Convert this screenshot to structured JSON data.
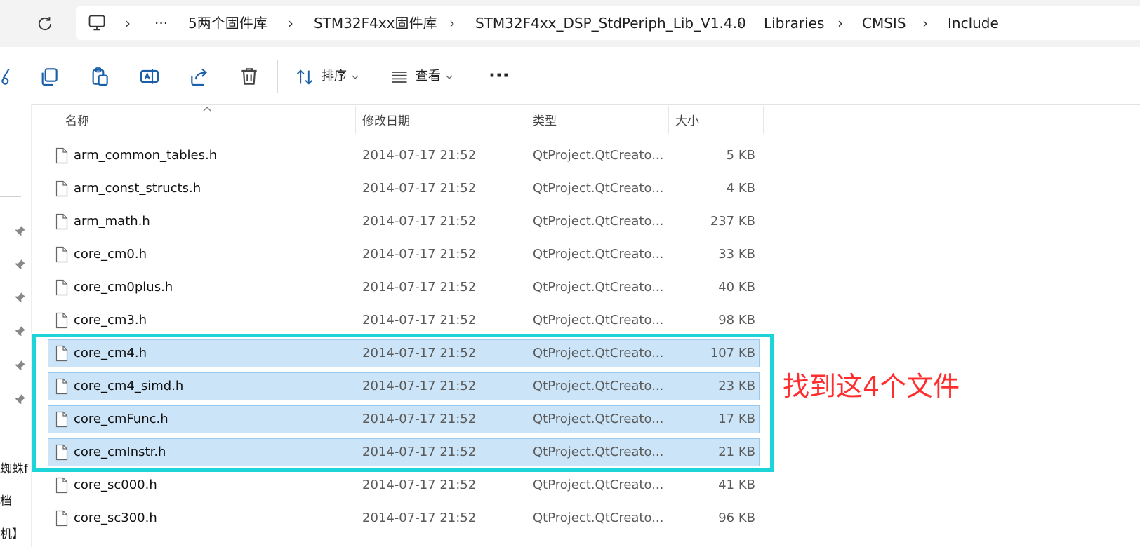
{
  "breadcrumbs": [
    "5两个固件库",
    "STM32F4xx固件库",
    "STM32F4xx_DSP_StdPeriph_Lib_V1.4.0",
    "Libraries",
    "CMSIS",
    "Include"
  ],
  "overflow_glyph": "···",
  "toolbar": {
    "sort_label": "排序",
    "view_label": "查看",
    "more_glyph": "···"
  },
  "columns": {
    "name": "名称",
    "date": "修改日期",
    "type": "类型",
    "size": "大小"
  },
  "files": [
    {
      "name": "arm_common_tables.h",
      "date": "2014-07-17 21:52",
      "type": "QtProject.QtCreato...",
      "size": "5 KB",
      "selected": false
    },
    {
      "name": "arm_const_structs.h",
      "date": "2014-07-17 21:52",
      "type": "QtProject.QtCreato...",
      "size": "4 KB",
      "selected": false
    },
    {
      "name": "arm_math.h",
      "date": "2014-07-17 21:52",
      "type": "QtProject.QtCreato...",
      "size": "237 KB",
      "selected": false
    },
    {
      "name": "core_cm0.h",
      "date": "2014-07-17 21:52",
      "type": "QtProject.QtCreato...",
      "size": "33 KB",
      "selected": false
    },
    {
      "name": "core_cm0plus.h",
      "date": "2014-07-17 21:52",
      "type": "QtProject.QtCreato...",
      "size": "40 KB",
      "selected": false
    },
    {
      "name": "core_cm3.h",
      "date": "2014-07-17 21:52",
      "type": "QtProject.QtCreato...",
      "size": "98 KB",
      "selected": false
    },
    {
      "name": "core_cm4.h",
      "date": "2014-07-17 21:52",
      "type": "QtProject.QtCreato...",
      "size": "107 KB",
      "selected": true
    },
    {
      "name": "core_cm4_simd.h",
      "date": "2014-07-17 21:52",
      "type": "QtProject.QtCreato...",
      "size": "23 KB",
      "selected": true
    },
    {
      "name": "core_cmFunc.h",
      "date": "2014-07-17 21:52",
      "type": "QtProject.QtCreato...",
      "size": "17 KB",
      "selected": true
    },
    {
      "name": "core_cmInstr.h",
      "date": "2014-07-17 21:52",
      "type": "QtProject.QtCreato...",
      "size": "21 KB",
      "selected": true
    },
    {
      "name": "core_sc000.h",
      "date": "2014-07-17 21:52",
      "type": "QtProject.QtCreato...",
      "size": "41 KB",
      "selected": false
    },
    {
      "name": "core_sc300.h",
      "date": "2014-07-17 21:52",
      "type": "QtProject.QtCreato...",
      "size": "96 KB",
      "selected": false
    }
  ],
  "annotation": "找到这4个文件",
  "nav_fragments": [
    "蜘蛛f",
    "档",
    "机】"
  ],
  "colors": {
    "selection": "#cce4f7",
    "highlight_box": "#1dd5d9",
    "annotation": "#ff2d2d",
    "icon": "#1a5fa8"
  }
}
